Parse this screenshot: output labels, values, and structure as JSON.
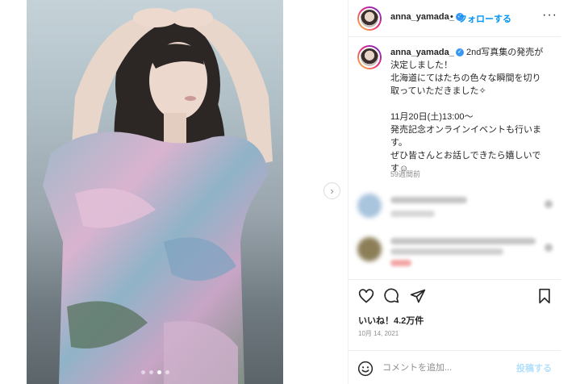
{
  "post": {
    "username": "anna_yamada_",
    "separator": "•",
    "follow_label": "フォローする",
    "more_label": "···",
    "caption": {
      "username": "anna_yamada_",
      "lines": [
        "2nd写真集の発売が",
        "決定しました！",
        "北海道にてはたちの色々な瞬間を切り",
        "取っていただきました✧",
        "",
        "11月20日(土)13:00〜",
        "発売記念オンラインイベントも行いま",
        "す。",
        "ぜひ皆さんとお話しできたら嬉しいで",
        "す☺"
      ]
    },
    "time_ago": "59週間前",
    "likes": "いいね！4.2万件",
    "date": "10月 14, 2021",
    "comment_placeholder": "コメントを追加...",
    "post_label": "投稿する",
    "next_arrow": "›",
    "carousel": {
      "count": 4,
      "active_index": 2
    }
  },
  "icons": {
    "verified": "verified-badge-icon",
    "like": "heart-icon",
    "comment": "comment-icon",
    "share": "paper-plane-icon",
    "save": "bookmark-icon",
    "emoji": "smiley-icon",
    "next": "chevron-right-icon"
  },
  "colors": {
    "accent": "#0095f6",
    "verified": "#3897f0",
    "post_disabled": "#b2dffc",
    "muted": "#8e8e8e"
  }
}
